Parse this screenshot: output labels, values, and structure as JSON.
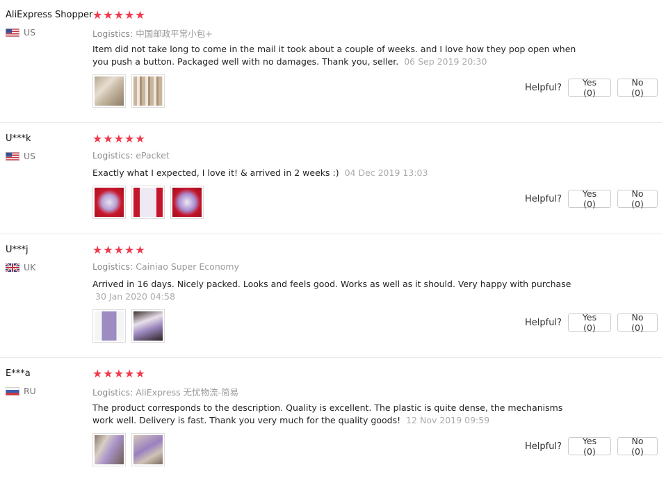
{
  "reviews": [
    {
      "user": "AliExpress Shopper",
      "country": "US",
      "flag": "us-flag-icon",
      "stars": "★★★★★",
      "logistics_label": "Logistics:",
      "logistics": "中国邮政平常小包+",
      "text": "Item did not take long to come in the mail it took about a couple of weeks. and I love how they pop open when you push a button. Packaged well with no damages. Thank you, seller.",
      "date": "06 Sep 2019 20:30",
      "helpful_label": "Helpful?",
      "yes": "Yes (0)",
      "no": "No (0)"
    },
    {
      "user": "U***k",
      "country": "US",
      "flag": "us-flag-icon",
      "stars": "★★★★★",
      "logistics_label": "Logistics:",
      "logistics": "ePacket",
      "text": "Exactly what I expected, I love it! & arrived in 2 weeks :)",
      "date": "04 Dec 2019 13:03",
      "helpful_label": "Helpful?",
      "yes": "Yes (0)",
      "no": "No (0)"
    },
    {
      "user": "U***j",
      "country": "UK",
      "flag": "uk-flag-icon",
      "stars": "★★★★★",
      "logistics_label": "Logistics:",
      "logistics": "Cainiao Super Economy",
      "text": "Arrived in 16 days. Nicely packed. Looks and feels good. Works as well as it should. Very happy with purchase",
      "date": "30 Jan 2020 04:58",
      "helpful_label": "Helpful?",
      "yes": "Yes (0)",
      "no": "No (0)"
    },
    {
      "user": "E***a",
      "country": "RU",
      "flag": "ru-flag-icon",
      "stars": "★★★★★",
      "logistics_label": "Logistics:",
      "logistics": "AliExpress 无忧物流-简易",
      "text": "The product corresponds to the description. Quality is excellent. The plastic is quite dense, the mechanisms work well. Delivery is fast. Thank you very much for the quality goods!",
      "date": "12 Nov 2019 09:59",
      "helpful_label": "Helpful?",
      "yes": "Yes (0)",
      "no": "No (0)"
    }
  ],
  "colors": {
    "star": "#f2394b",
    "muted": "#999999",
    "separator": "#e8e8e8"
  }
}
